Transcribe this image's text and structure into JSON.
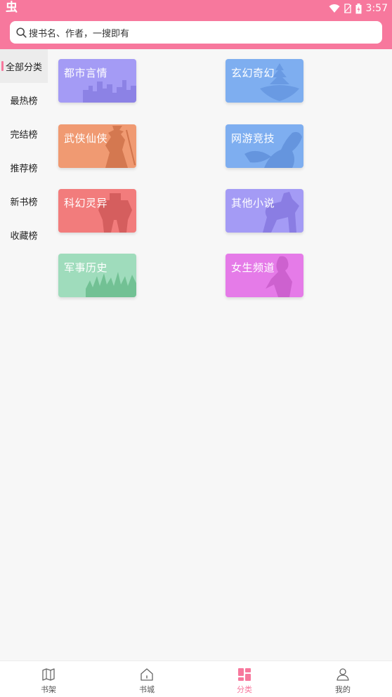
{
  "status": {
    "app_glyph": "虫",
    "time": "3:57"
  },
  "search": {
    "placeholder": "搜书名、作者，一搜即有"
  },
  "sidebar": {
    "items": [
      {
        "label": "全部分类",
        "active": true
      },
      {
        "label": "最热榜"
      },
      {
        "label": "完结榜"
      },
      {
        "label": "推荐榜"
      },
      {
        "label": "新书榜"
      },
      {
        "label": "收藏榜"
      }
    ]
  },
  "categories": [
    {
      "label": "都市言情",
      "color": "#a49bf5",
      "icon": "city-skyline-icon"
    },
    {
      "label": "玄幻奇幻",
      "color": "#7eaef0",
      "icon": "floating-temple-icon"
    },
    {
      "label": "武侠仙侠",
      "color": "#f09a72",
      "icon": "swordsman-icon"
    },
    {
      "label": "网游竞技",
      "color": "#7eaef0",
      "icon": "game-character-icon"
    },
    {
      "label": "科幻灵异",
      "color": "#f27c7c",
      "icon": "robot-icon"
    },
    {
      "label": "其他小说",
      "color": "#a49bf5",
      "icon": "rider-icon"
    },
    {
      "label": "军事历史",
      "color": "#9fdcbc",
      "icon": "army-icon"
    },
    {
      "label": "女生频道",
      "color": "#e57be8",
      "icon": "girl-icon"
    }
  ],
  "bottom_nav": {
    "items": [
      {
        "label": "书架",
        "icon": "bookshelf-icon"
      },
      {
        "label": "书城",
        "icon": "home-icon"
      },
      {
        "label": "分类",
        "icon": "category-icon",
        "active": true
      },
      {
        "label": "我的",
        "icon": "profile-icon"
      }
    ]
  },
  "colors": {
    "accent": "#f7789d"
  }
}
